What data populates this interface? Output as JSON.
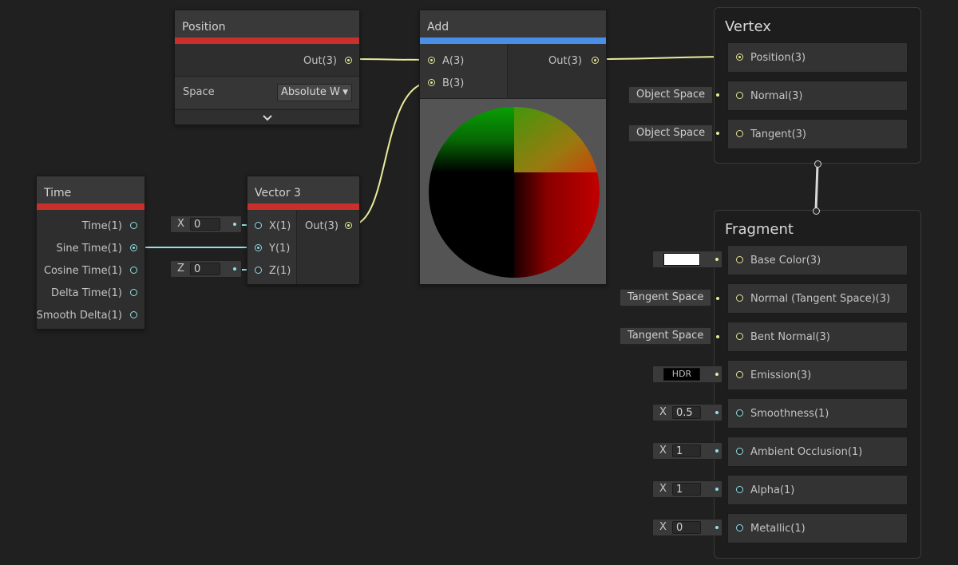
{
  "nodes": {
    "position": {
      "title": "Position",
      "out": "Out(3)",
      "space_label": "Space",
      "space_value": "Absolute Wo",
      "expand_icon": "chevron-down-icon"
    },
    "add": {
      "title": "Add",
      "in_a": "A(3)",
      "in_b": "B(3)",
      "out": "Out(3)"
    },
    "time": {
      "title": "Time",
      "outputs": [
        "Time(1)",
        "Sine Time(1)",
        "Cosine Time(1)",
        "Delta Time(1)",
        "Smooth Delta(1)"
      ]
    },
    "vector3": {
      "title": "Vector 3",
      "in_x": "X(1)",
      "in_y": "Y(1)",
      "in_z": "Z(1)",
      "out": "Out(3)",
      "x_field_label": "X",
      "x_field_value": "0",
      "z_field_label": "Z",
      "z_field_value": "0"
    }
  },
  "vertex": {
    "title": "Vertex",
    "blocks": [
      "Position(3)",
      "Normal(3)",
      "Tangent(3)"
    ],
    "normal_space": "Object Space",
    "tangent_space": "Object Space"
  },
  "fragment": {
    "title": "Fragment",
    "blocks": [
      "Base Color(3)",
      "Normal (Tangent Space)(3)",
      "Bent Normal(3)",
      "Emission(3)",
      "Smoothness(1)",
      "Ambient Occlusion(1)",
      "Alpha(1)",
      "Metallic(1)"
    ],
    "normal_space": "Tangent Space",
    "bent_normal_space": "Tangent Space",
    "emission_label": "HDR",
    "x_label": "X",
    "smoothness_value": "0.5",
    "ao_value": "1",
    "alpha_value": "1",
    "metallic_value": "0"
  },
  "colors": {
    "background": "#202020",
    "node_body": "#2e2e2e",
    "node_title": "#393939",
    "vector_port": "#e8e89a",
    "float_port": "#8fe0e8",
    "accent_red": "#c9302c",
    "accent_blue": "#4a8fe7"
  }
}
